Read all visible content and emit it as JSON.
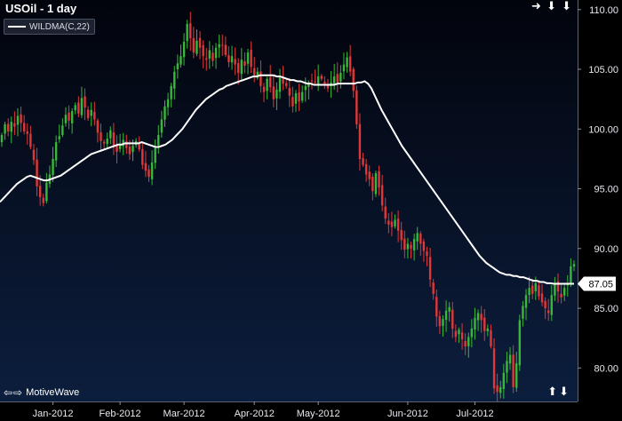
{
  "chart_data": {
    "type": "candlestick",
    "title": "USOil - 1 day",
    "indicator_label": "WILDMA(C,22)",
    "indicator_color": "#ffffff",
    "up_color": "#38b838",
    "down_color": "#e03838",
    "background_top": "#02040c",
    "background_bottom": "#0c1e3e",
    "ylim": [
      77.2,
      110.8
    ],
    "y_ticks": [
      "80.00",
      "85.00",
      "90.00",
      "95.00",
      "100.00",
      "105.00",
      "110.00"
    ],
    "x_ticks": [
      "Jan-2012",
      "Feb-2012",
      "Mar-2012",
      "Apr-2012",
      "May-2012",
      "Jun-2012",
      "Jul-2012"
    ],
    "last_value": "87.05",
    "grid": false,
    "legend_position": "top-left",
    "closes": [
      99.5,
      100.4,
      99.8,
      100.6,
      100.2,
      101.1,
      100.5,
      99.8,
      99.6,
      98.5,
      97.4,
      95.2,
      94.3,
      93.8,
      95.5,
      96.2,
      97.5,
      98.9,
      99.4,
      100.3,
      101.2,
      100.7,
      101.5,
      102.0,
      101.3,
      102.6,
      101.8,
      100.9,
      101.6,
      100.8,
      99.7,
      99.0,
      98.8,
      99.2,
      99.9,
      98.6,
      98.1,
      98.7,
      99.1,
      98.4,
      97.9,
      98.6,
      99.0,
      98.3,
      97.0,
      96.5,
      96.0,
      97.2,
      98.4,
      99.5,
      100.8,
      101.9,
      102.5,
      103.6,
      104.8,
      105.5,
      106.1,
      107.3,
      108.8,
      107.6,
      106.4,
      107.4,
      106.8,
      106.1,
      105.8,
      106.6,
      105.7,
      106.8,
      107.1,
      107.0,
      106.2,
      105.6,
      106.1,
      105.4,
      104.7,
      105.8,
      105.3,
      106.4,
      105.2,
      104.5,
      104.8,
      103.6,
      103.1,
      104.2,
      103.5,
      102.5,
      103.3,
      104.3,
      103.8,
      103.6,
      102.8,
      101.9,
      103.0,
      102.3,
      103.1,
      103.6,
      103.9,
      104.0,
      103.9,
      104.4,
      104.2,
      103.8,
      103.4,
      103.9,
      104.4,
      103.9,
      104.7,
      105.4,
      106.0,
      104.8,
      103.2,
      100.4,
      97.5,
      97.0,
      96.2,
      95.8,
      94.8,
      96.3,
      95.1,
      93.6,
      92.5,
      92.0,
      91.8,
      92.4,
      91.5,
      90.7,
      89.9,
      90.4,
      90.0,
      90.8,
      91.3,
      90.4,
      89.8,
      89.4,
      87.4,
      86.2,
      84.3,
      83.5,
      84.1,
      84.8,
      85.1,
      83.3,
      82.6,
      83.2,
      82.4,
      81.8,
      82.6,
      83.3,
      84.2,
      84.6,
      84.0,
      83.1,
      83.3,
      81.8,
      78.3,
      78.0,
      78.4,
      79.6,
      80.6,
      81.1,
      78.4,
      80.4,
      84.0,
      85.2,
      86.1,
      86.7,
      86.2,
      87.1,
      86.0,
      85.5,
      85.0,
      84.6,
      86.1,
      87.1,
      86.4,
      85.9,
      86.7,
      87.1,
      88.5,
      88.7
    ],
    "wildma": [
      93.9,
      94.2,
      94.5,
      94.8,
      95.1,
      95.4,
      95.6,
      95.8,
      96.0,
      96.1,
      96.0,
      95.9,
      95.8,
      95.7,
      95.7,
      95.8,
      95.9,
      96.0,
      96.1,
      96.3,
      96.5,
      96.7,
      96.9,
      97.1,
      97.3,
      97.5,
      97.7,
      97.9,
      98.0,
      98.1,
      98.2,
      98.3,
      98.4,
      98.5,
      98.6,
      98.7,
      98.7,
      98.8,
      98.8,
      98.8,
      98.8,
      98.8,
      98.9,
      98.8,
      98.7,
      98.6,
      98.5,
      98.5,
      98.6,
      98.7,
      98.9,
      99.1,
      99.4,
      99.7,
      100.0,
      100.4,
      100.8,
      101.2,
      101.6,
      101.9,
      102.2,
      102.5,
      102.7,
      102.9,
      103.1,
      103.3,
      103.4,
      103.6,
      103.7,
      103.8,
      103.9,
      104.0,
      104.1,
      104.2,
      104.3,
      104.4,
      104.4,
      104.5,
      104.5,
      104.5,
      104.5,
      104.5,
      104.4,
      104.4,
      104.3,
      104.2,
      104.1,
      104.1,
      104.0,
      104.0,
      103.9,
      103.8,
      103.8,
      103.7,
      103.7,
      103.7,
      103.7,
      103.7,
      103.7,
      103.7,
      103.8,
      103.8,
      103.8,
      103.8,
      103.8,
      103.8,
      103.9,
      103.9,
      104.0,
      103.8,
      103.4,
      102.8,
      102.2,
      101.6,
      101.1,
      100.6,
      100.1,
      99.6,
      99.1,
      98.6,
      98.2,
      97.8,
      97.4,
      97.0,
      96.6,
      96.2,
      95.8,
      95.4,
      95.0,
      94.6,
      94.2,
      93.8,
      93.4,
      93.0,
      92.6,
      92.2,
      91.8,
      91.4,
      91.0,
      90.6,
      90.2,
      89.8,
      89.4,
      89.1,
      88.8,
      88.6,
      88.4,
      88.2,
      88.0,
      87.9,
      87.8,
      87.8,
      87.7,
      87.7,
      87.6,
      87.6,
      87.5,
      87.4,
      87.3,
      87.3,
      87.2,
      87.2,
      87.1,
      87.1,
      87.05,
      87.05,
      87.05,
      87.05,
      87.05,
      87.05,
      87.05
    ]
  },
  "brand": {
    "name": "MotiveWave",
    "arrows": "⇔",
    "updown": "⇧⇩"
  },
  "nav": {
    "top": "➜➜➜"
  },
  "colors": {
    "axis_text": "#e6e9f0",
    "label_box": "#ffffff"
  }
}
